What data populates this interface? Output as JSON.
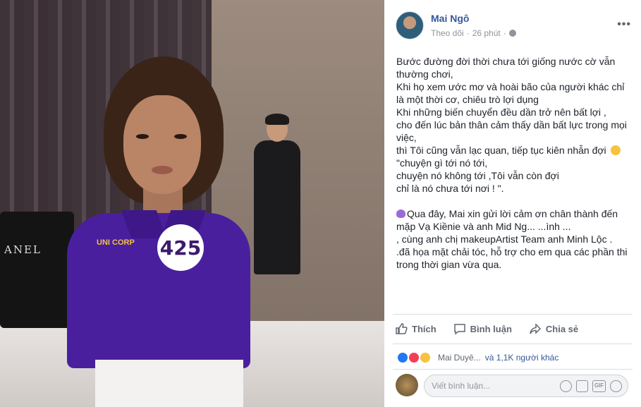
{
  "photo": {
    "badge_number": "425",
    "shirt_logo": "UNI CORP",
    "bag_brand": "ANEL"
  },
  "post": {
    "author": "Mai Ngô",
    "follow": "Theo dõi",
    "separator": "·",
    "time": "26 phút",
    "more": "•••",
    "lines": [
      "Bước đường đời thời chưa tới giống nước cờ vẫn",
      "thường chơi,",
      "Khi họ xem ước mơ và hoài bão của người khác chỉ",
      "là một thời cơ, chiêu trò lợi dụng",
      "Khi những biến chuyển đều dần trở nên bất lợi ,",
      "cho đến lúc bản thân cảm thấy dần bất lực trong mọi",
      "việc,",
      "thì Tôi cũng vẫn lạc quan, tiếp tục kiên nhẫn đợi",
      "\"chuyện gì tới nó tới,",
      "chuyện nó không tới ,Tôi vẫn còn đợi",
      "chỉ là nó chưa tới nơi ! \"."
    ],
    "lines2": [
      "Qua đây, Mai xin gửi lời cảm ơn chân thành đến",
      "mặp Vạ Kiềnie và anh Mid Ng... ...ình ...",
      ", cùng anh chị makeupArtist Team anh Minh Lộc .",
      ".đã họa mặt chải tóc, hỗ trợ cho em qua các phần thi",
      "trong thời gian vừa qua."
    ]
  },
  "actions": {
    "like": "Thích",
    "comment": "Bình luận",
    "share": "Chia sẻ"
  },
  "reactions": {
    "names": "Mai Duyê...",
    "others": "và 1,1K người khác"
  },
  "comment": {
    "placeholder": "Viết bình luận...",
    "gif": "GIF"
  }
}
